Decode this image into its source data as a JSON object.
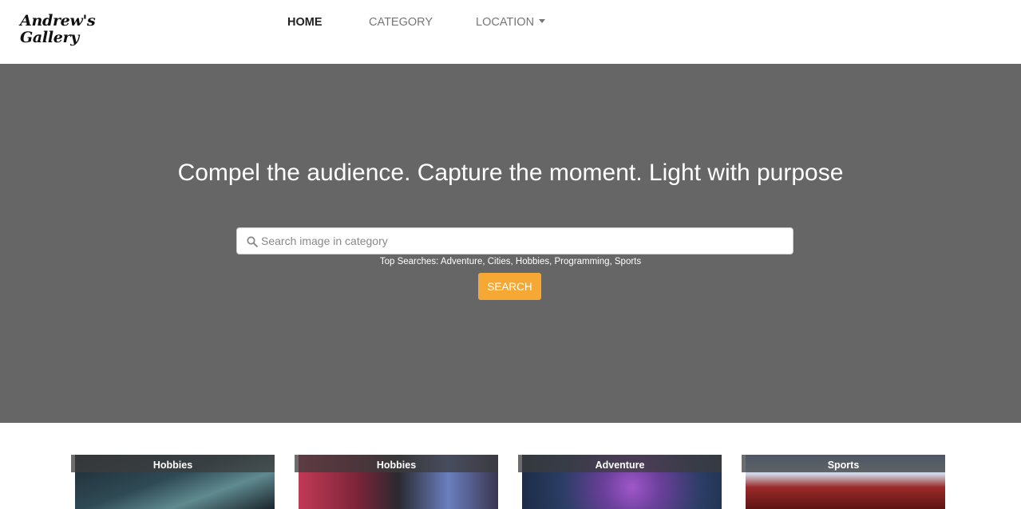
{
  "brand": {
    "line1": "Andrew's",
    "line2": "Gallery"
  },
  "nav": [
    {
      "label": "HOME",
      "active": true
    },
    {
      "label": "CATEGORY",
      "active": false
    },
    {
      "label": "LOCATION",
      "active": false,
      "dropdown": true
    }
  ],
  "hero": {
    "title": "Compel the audience. Capture the moment. Light with purpose",
    "search_placeholder": "Search image in category",
    "top_searches": "Top Searches: Adventure, Cities, Hobbies, Programming, Sports",
    "search_button": "SEARCH"
  },
  "cards": [
    {
      "label": "Hobbies"
    },
    {
      "label": "Hobbies"
    },
    {
      "label": "Adventure"
    },
    {
      "label": "Sports"
    }
  ],
  "colors": {
    "hero_bg": "#666666",
    "accent": "#f5a834"
  }
}
